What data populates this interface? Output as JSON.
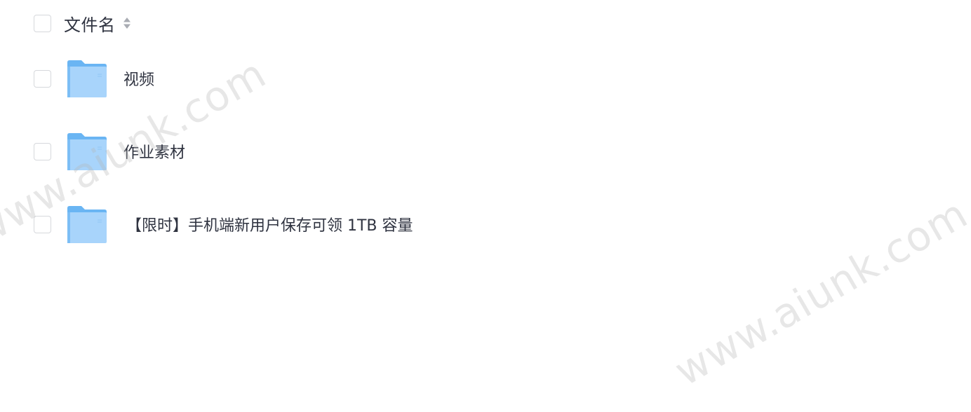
{
  "header": {
    "column_label": "文件名"
  },
  "files": [
    {
      "name": "视频",
      "icon": "folder-icon"
    },
    {
      "name": "作业素材",
      "icon": "folder-icon"
    },
    {
      "name": "【限时】手机端新用户保存可领 1TB 容量",
      "icon": "folder-icon"
    }
  ],
  "watermark": {
    "text_1": "www.aiunk.com",
    "text_2": "www.aiunk.com"
  },
  "colors": {
    "text": "#2f3340",
    "checkbox_border": "#d6d8dc",
    "folder_light": "#a8d4fb",
    "folder_dark": "#6ab5f3"
  }
}
